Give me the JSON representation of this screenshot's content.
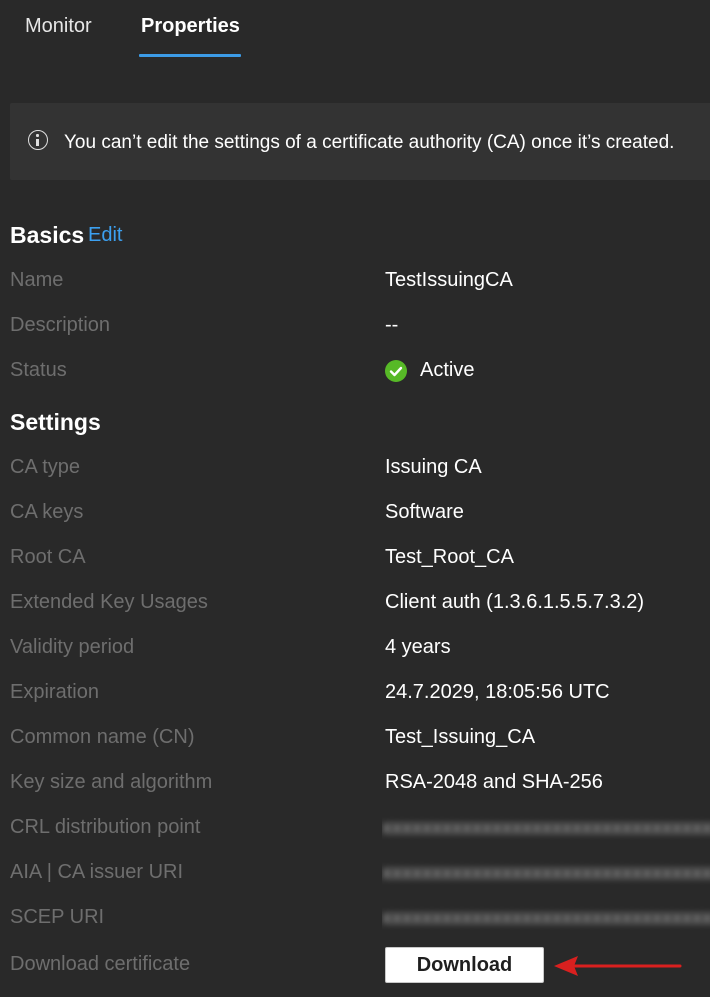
{
  "tabs": [
    {
      "label": "Monitor",
      "active": false
    },
    {
      "label": "Properties",
      "active": true
    }
  ],
  "banner": {
    "icon": "info-icon",
    "message": "You can’t edit the settings of a certificate authority (CA) once it’s created."
  },
  "basics": {
    "title": "Basics",
    "edit_label": "Edit",
    "rows": [
      {
        "label": "Name",
        "value": "TestIssuingCA"
      },
      {
        "label": "Description",
        "value": "--"
      },
      {
        "label": "Status",
        "value": "Active",
        "icon": "check-circle-icon",
        "icon_color": "#57b927"
      }
    ]
  },
  "settings": {
    "title": "Settings",
    "rows": [
      {
        "label": "CA type",
        "value": "Issuing CA"
      },
      {
        "label": "CA keys",
        "value": "Software"
      },
      {
        "label": "Root CA",
        "value": "Test_Root_CA"
      },
      {
        "label": "Extended Key Usages",
        "value": "Client auth (1.3.6.1.5.5.7.3.2)"
      },
      {
        "label": "Validity period",
        "value": "4 years"
      },
      {
        "label": "Expiration",
        "value": "24.7.2029, 18:05:56 UTC"
      },
      {
        "label": "Common name (CN)",
        "value": "Test_Issuing_CA"
      },
      {
        "label": "Key size and algorithm",
        "value": "RSA-2048 and SHA-256"
      },
      {
        "label": "CRL distribution point",
        "value": "",
        "redacted": true
      },
      {
        "label": "AIA | CA issuer URI",
        "value": "",
        "redacted": true
      },
      {
        "label": "SCEP URI",
        "value": "",
        "redacted": true
      },
      {
        "label": "Download certificate",
        "button": "Download"
      }
    ]
  },
  "colors": {
    "background": "#292929",
    "accent": "#3c9be6",
    "label_text": "#6e6e6e",
    "annotation_arrow": "#d9201f"
  }
}
